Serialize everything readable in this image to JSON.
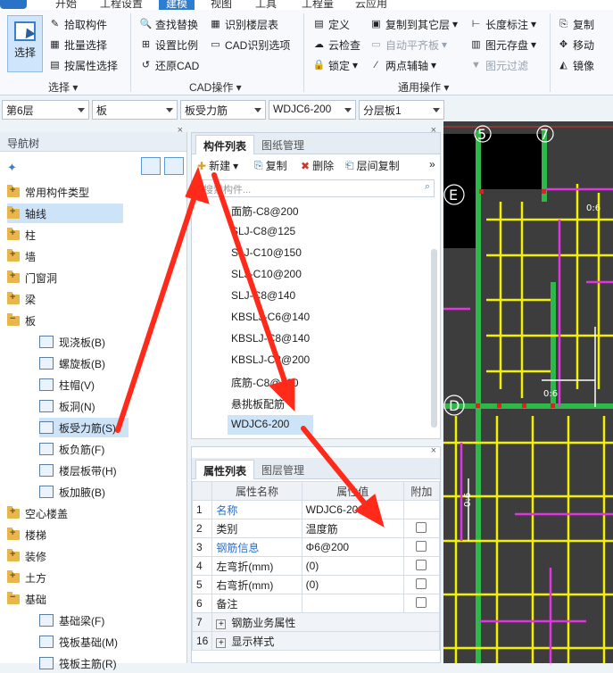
{
  "menu_tabs": [
    "开始",
    "工程设置",
    "建模",
    "视图",
    "工具",
    "工程量",
    "云应用"
  ],
  "active_tab": "建模",
  "ribbon": {
    "select_label": "选择",
    "group_select": {
      "label": "选择",
      "items": [
        "拾取构件",
        "批量选择",
        "按属性选择"
      ]
    },
    "group_cad": {
      "label": "CAD操作",
      "items": [
        "查找替换",
        "识别楼层表",
        "设置比例",
        "CAD识别选项",
        "还原CAD"
      ]
    },
    "group_general": {
      "label": "通用操作",
      "items": [
        "定义",
        "复制到其它层",
        "长度标注",
        "复制",
        "云检查",
        "自动平齐板",
        "图元存盘",
        "移动",
        "锁定",
        "两点辅轴",
        "图元过滤",
        "镜像"
      ]
    }
  },
  "selectors": [
    "第6层",
    "板",
    "板受力筋",
    "WDJC6-200",
    "分层板1"
  ],
  "nav": {
    "title": "导航树",
    "items": [
      {
        "label": "常用构件类型",
        "type": "folder"
      },
      {
        "label": "轴线",
        "type": "folder"
      },
      {
        "label": "柱",
        "type": "folder"
      },
      {
        "label": "墙",
        "type": "folder"
      },
      {
        "label": "门窗洞",
        "type": "folder"
      },
      {
        "label": "梁",
        "type": "folder"
      },
      {
        "label": "板",
        "type": "folder-open"
      },
      {
        "label": "现浇板(B)",
        "type": "sub"
      },
      {
        "label": "螺旋板(B)",
        "type": "sub"
      },
      {
        "label": "柱帽(V)",
        "type": "sub"
      },
      {
        "label": "板洞(N)",
        "type": "sub"
      },
      {
        "label": "板受力筋(S)",
        "type": "sub"
      },
      {
        "label": "板负筋(F)",
        "type": "sub"
      },
      {
        "label": "楼层板带(H)",
        "type": "sub"
      },
      {
        "label": "板加腋(B)",
        "type": "sub"
      },
      {
        "label": "空心楼盖",
        "type": "folder"
      },
      {
        "label": "楼梯",
        "type": "folder"
      },
      {
        "label": "装修",
        "type": "folder"
      },
      {
        "label": "土方",
        "type": "folder"
      },
      {
        "label": "基础",
        "type": "folder-open"
      },
      {
        "label": "基础梁(F)",
        "type": "sub"
      },
      {
        "label": "筏板基础(M)",
        "type": "sub"
      },
      {
        "label": "筏板主筋(R)",
        "type": "sub"
      }
    ]
  },
  "component_panel": {
    "tab_active": "构件列表",
    "tab_other": "图纸管理",
    "toolbar": [
      "新建",
      "复制",
      "删除",
      "层间复制"
    ],
    "search_placeholder": "搜索构件...",
    "items": [
      "面筋-C8@200",
      "SLJ-C8@125",
      "SLJ-C10@150",
      "SLJ-C10@200",
      "SLJ-C8@140",
      "KBSLJ-C6@140",
      "KBSLJ-C8@140",
      "KBSLJ-C8@200",
      "底筋-C8@200",
      "悬挑板配筋",
      "WDJC6-200"
    ],
    "selected": "WDJC6-200"
  },
  "property_panel": {
    "tab_active": "属性列表",
    "tab_other": "图层管理",
    "headers": [
      "",
      "属性名称",
      "属性值",
      "附加"
    ],
    "rows": [
      {
        "num": "1",
        "name": "名称",
        "value": "WDJC6-200",
        "blue": true,
        "checkbox": false
      },
      {
        "num": "2",
        "name": "类别",
        "value": "温度筋",
        "blue": false,
        "checkbox": true
      },
      {
        "num": "3",
        "name": "钢筋信息",
        "value": "Φ6@200",
        "blue": true,
        "checkbox": true
      },
      {
        "num": "4",
        "name": "左弯折(mm)",
        "value": "(0)",
        "blue": false,
        "checkbox": true
      },
      {
        "num": "5",
        "name": "右弯折(mm)",
        "value": "(0)",
        "blue": false,
        "checkbox": true
      },
      {
        "num": "6",
        "name": "备注",
        "value": "",
        "blue": false,
        "checkbox": true
      },
      {
        "num": "7",
        "name": "钢筋业务属性",
        "value": "",
        "blue": false,
        "expand": true
      },
      {
        "num": "16",
        "name": "显示样式",
        "value": "",
        "blue": false,
        "expand": true
      }
    ]
  },
  "cad": {
    "axis_labels": [
      "5",
      "7",
      "E",
      "D"
    ],
    "dims": [
      "0:6",
      "0:6",
      "0:6"
    ]
  },
  "colors": {
    "accent": "#2d7dd2",
    "annotation_arrow": "#ff2a1a",
    "cad_bg": "#3d3d3d"
  }
}
